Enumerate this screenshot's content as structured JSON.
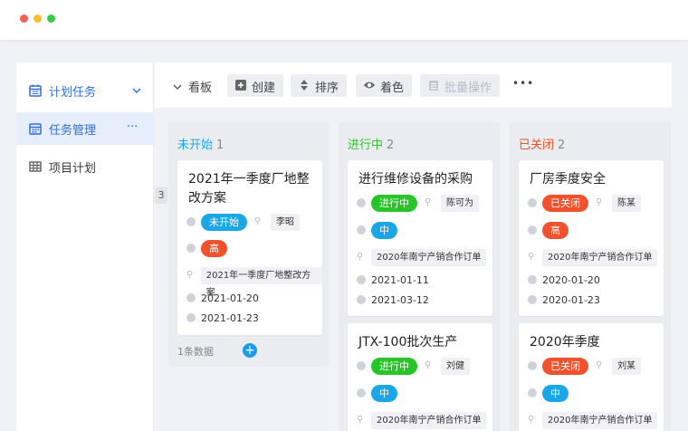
{
  "window": {
    "dots": [
      "#f25f58",
      "#fbbe2e",
      "#3ac945"
    ]
  },
  "sidebar": {
    "items": [
      {
        "label": "计划任务",
        "icon": "calendar-icon"
      },
      {
        "label": "任务管理",
        "icon": "calendar-grid-icon",
        "more": "···"
      },
      {
        "label": "项目计划",
        "icon": "table-icon"
      }
    ]
  },
  "toolbar": {
    "view_label": "看板",
    "create_label": "创建",
    "sort_label": "排序",
    "color_label": "着色",
    "batch_label": "批量操作",
    "more_label": "•••"
  },
  "board": {
    "side_count": "3",
    "columns": [
      {
        "name": "未开始",
        "count": "1",
        "color": "#1ba7e6",
        "cards": [
          {
            "title": "2021年一季度厂地整改方案",
            "status": "未开始",
            "status_color": "#1ba7e6",
            "person": "李昭",
            "priority": "高",
            "priority_color": "#f0522e",
            "order": "2021年一季度厂地整改方案",
            "start": "2021-01-20",
            "end": "2021-01-23"
          }
        ],
        "footer": "1条数据"
      },
      {
        "name": "进行中",
        "count": "2",
        "color": "#2fc42f",
        "cards": [
          {
            "title": "进行维修设备的采购",
            "status": "进行中",
            "status_color": "#29c429",
            "person": "陈可为",
            "priority": "中",
            "priority_color": "#1ba7e6",
            "order": "2020年南宁产销合作订单",
            "start": "2021-01-11",
            "end": "2021-03-12"
          },
          {
            "title": "JTX-100批次生产",
            "status": "进行中",
            "status_color": "#29c429",
            "person": "刘健",
            "priority": "中",
            "priority_color": "#1ba7e6",
            "order": "2020年南宁产销合作订单"
          }
        ]
      },
      {
        "name": "已关闭",
        "count": "2",
        "color": "#e8522e",
        "cards": [
          {
            "title": "厂房季度安全",
            "status": "已关闭",
            "status_color": "#f0522e",
            "person": "陈某",
            "priority": "高",
            "priority_color": "#f0522e",
            "order": "2020年南宁产销合作订单",
            "start": "2020-01-20",
            "end": "2020-01-23"
          },
          {
            "title": "2020年季度",
            "status": "已关闭",
            "status_color": "#f0522e",
            "person": "刘某",
            "priority": "中",
            "priority_color": "#1ba7e6",
            "order": "2020年南宁产销合作订单"
          }
        ]
      }
    ]
  }
}
